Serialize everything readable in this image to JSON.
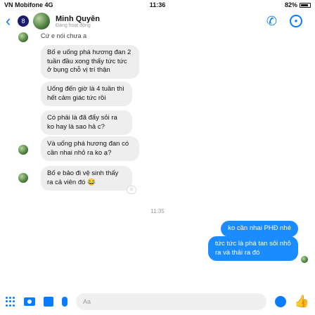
{
  "status_bar": {
    "carrier": "VN Mobifone  4G",
    "time": "11:36",
    "battery": "82%"
  },
  "header": {
    "back_badge": "8",
    "contact_name": "Minh Quyên",
    "contact_status": "Đang hoạt động"
  },
  "messages": {
    "cut_line": "Cứ e nói chưa ạ",
    "incoming": [
      "Bố e uống phá hương đan 2 tuần đầu xong thấy tức tức ở bụng chỗ vị trí thận",
      "Uống đến giờ là 4 tuần thì hết cảm giác tức rồi",
      "Có phải là đã đẩy sỏi ra ko hay là sao hả c?",
      "Và uống phá hương đan có cần nhai nhỏ ra ko ạ?",
      "Bố e bảo đi vệ sinh thấy ra cả viên đó 😂"
    ],
    "timestamp": "11:35",
    "outgoing": [
      "ko cần nhai PHĐ nhé",
      "tức tức là phá tan sỏi nhỏ ra và thải ra đó"
    ]
  },
  "composer": {
    "placeholder": "Aa"
  },
  "colors": {
    "accent": "#0a7cff",
    "outgoing_bubble": "#1a8cff",
    "incoming_bubble": "#eeeeee"
  }
}
